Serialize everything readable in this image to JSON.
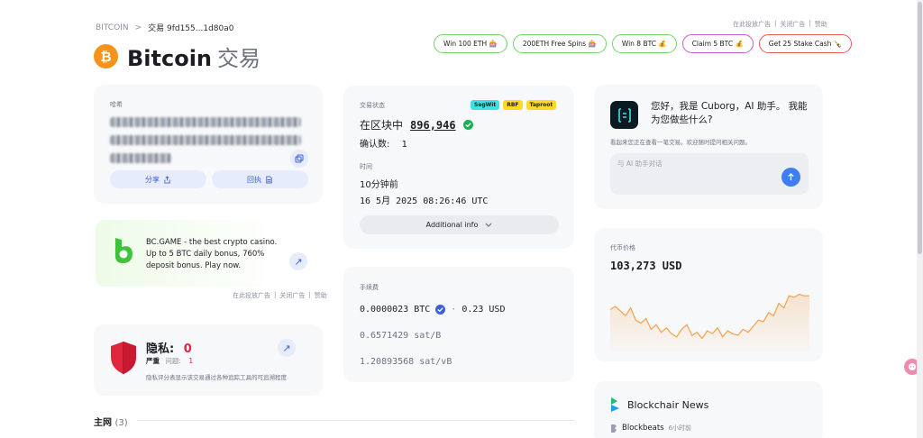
{
  "breadcrumb": {
    "root": "BITCOIN",
    "separator": ">",
    "current": "交易 9fd155...1d80a0"
  },
  "header": {
    "title": "Bitcoin",
    "subtitle": "交易",
    "logo_glyph": "₿"
  },
  "ad_links": {
    "report": "在此投放广告",
    "close": "关闭广告",
    "help": "赞助",
    "sep": "|"
  },
  "promos": [
    {
      "label": "Win 100 ETH 🎰"
    },
    {
      "label": "200ETH Free Spins 🎰"
    },
    {
      "label": "Win 8 BTC 💰"
    },
    {
      "label": "Claim 5 BTC 💰"
    },
    {
      "label": "Get 25 Stake Cash 🍾"
    }
  ],
  "hash_card": {
    "label": "哈希",
    "share_label": "分享",
    "receipt_label": "回执"
  },
  "bc_ad": {
    "text": "BC.GAME - the best crypto casino. Up to 5 BTC daily bonus, 760% deposit bonus. Play now."
  },
  "privacy": {
    "title": "隐私:",
    "score": "0",
    "severity": "严重",
    "issue_label": "问题:",
    "issue_count": "1",
    "desc": "隐私评分表显示该交易通过各种追踪工具的可追溯程度"
  },
  "section_main": {
    "title": "主网",
    "count": "(3)"
  },
  "status_card": {
    "label": "交易状态",
    "tags": [
      "SegWit",
      "RBF",
      "Taproot"
    ],
    "state": "在区块中",
    "block": "896,946",
    "confirm_label": "确认数:",
    "confirmations": "1",
    "time_label": "时间",
    "relative_time": "10分钟前",
    "absolute_time": "16 5月 2025 08:26:46 UTC",
    "additional_label": "Additional info"
  },
  "fee_card": {
    "label": "手续费",
    "btc": "0.0000023 BTC",
    "dot": "·",
    "usd": "0.23 USD",
    "sat_b": "0.6571429 sat/B",
    "sat_vb": "1.20893568 sat/vB"
  },
  "ai_card": {
    "greeting": "您好，我是 Cuborg，AI 助手。 我能为您做些什么?",
    "hint": "看起来您正在查看一笔交易。欢迎随时提问相关问题。",
    "input_placeholder": "与 AI 助手对话"
  },
  "price_card": {
    "label": "代币价格",
    "price": "103,273 USD",
    "chart_data": {
      "type": "area",
      "y": [
        62,
        64,
        61,
        58,
        63,
        55,
        53,
        56,
        49,
        52,
        47,
        50,
        46,
        44,
        49,
        52,
        45,
        47,
        43,
        48,
        46,
        50,
        44,
        48,
        46,
        45,
        49,
        47,
        51,
        55,
        54,
        60,
        58,
        66,
        63,
        71,
        70,
        72,
        71,
        71
      ]
    }
  },
  "news_card": {
    "title": "Blockchair News",
    "source": "Blockbeats",
    "age": "6小时前"
  },
  "colors": {
    "accent": "#3d5fd8",
    "bitcoin": "#f7931a",
    "danger": "#e0263d",
    "chart": "#f5a04a"
  }
}
